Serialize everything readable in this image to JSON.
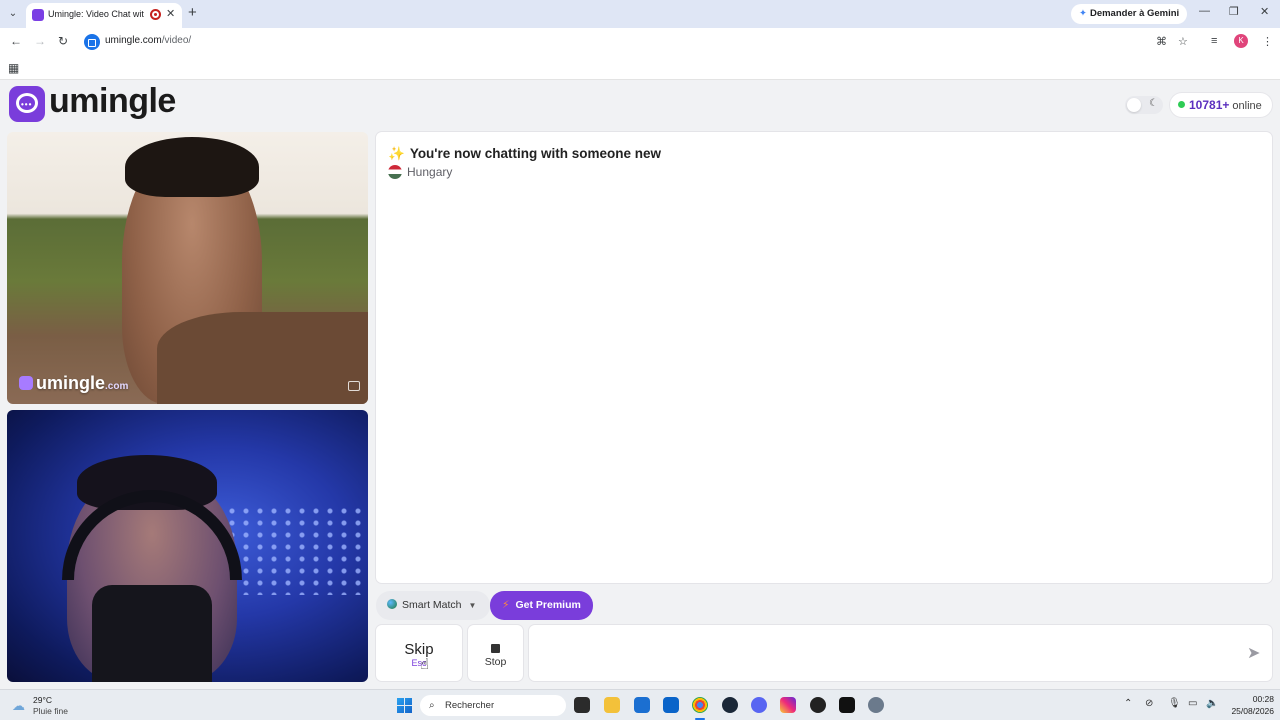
{
  "browser": {
    "tab_title": "Umingle: Video Chat with Strangers",
    "tab_close": "✕",
    "new_tab": "+",
    "gemini_label": "Demander à Gemini",
    "url_host": "umingle.com",
    "url_path": "/video/",
    "profile_initial": "K",
    "icons": [
      "tab-menu-icon",
      "back-icon",
      "forward-icon",
      "reload-icon",
      "translate-icon",
      "star-icon",
      "media-icon",
      "menu-icon",
      "apps-icon"
    ]
  },
  "header": {
    "logo_text": "umingle",
    "online_count": "10781+",
    "online_label": "online"
  },
  "video": {
    "watermark": "umingle",
    "watermark_domain": ".com"
  },
  "chat": {
    "system_message": "You're now chatting with someone new",
    "country": "Hungary",
    "input_placeholder": "",
    "input_value": ""
  },
  "controls": {
    "smart_match": "Smart Match",
    "get_premium": "Get Premium",
    "skip": "Skip",
    "skip_key": "Esc",
    "stop": "Stop"
  },
  "taskbar": {
    "temperature": "29°C",
    "weather_desc": "Pluie fine",
    "search": "Rechercher",
    "time": "00:28",
    "date": "25/08/2026"
  },
  "colors": {
    "brand": "#7a3ddb",
    "online_dot": "#2ecc55",
    "online_count": "#5b2fbf"
  }
}
